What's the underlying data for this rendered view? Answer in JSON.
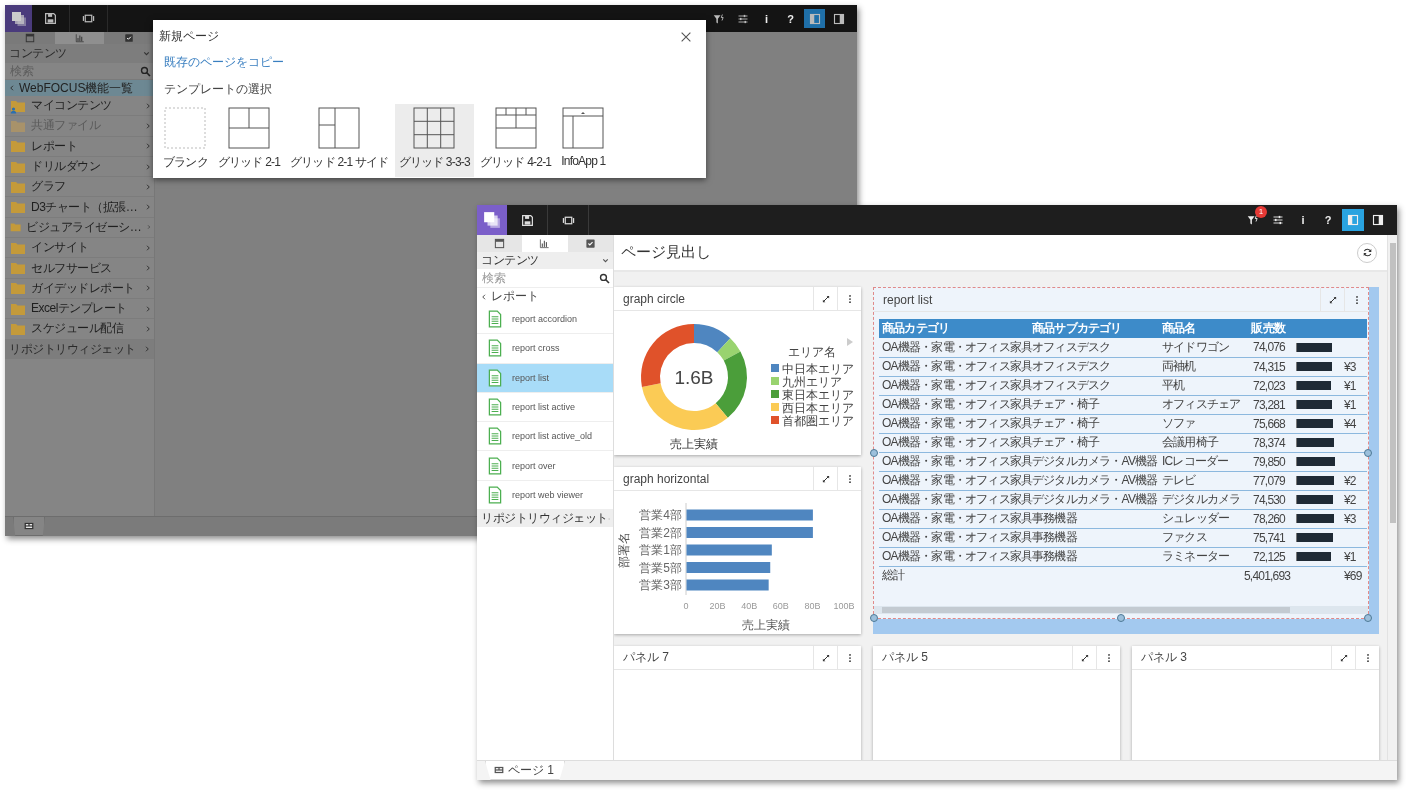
{
  "back_window": {
    "toolbar": {
      "left": [
        {
          "kind": "logo"
        },
        {
          "kind": "save"
        },
        {
          "kind": "slideshow"
        }
      ],
      "right": [
        {
          "kind": "filter",
          "selected": false
        },
        {
          "kind": "sliders",
          "selected": false
        },
        {
          "kind": "info",
          "label": "i",
          "selected": false
        },
        {
          "kind": "help",
          "label": "?",
          "selected": false
        },
        {
          "kind": "panel-left",
          "selected": true
        },
        {
          "kind": "panel-right",
          "selected": false
        }
      ]
    },
    "sidebar": {
      "tabs": [
        {
          "kind": "layout",
          "selected": false
        },
        {
          "kind": "chart",
          "selected": true
        },
        {
          "kind": "checkbox",
          "selected": false
        }
      ],
      "section": "コンテンツ",
      "search": {
        "placeholder": "検索"
      },
      "back": {
        "label": "WebFOCUS機能一覧",
        "highlighted": true
      },
      "items": [
        {
          "label": "マイコンテンツ",
          "kind": "user"
        },
        {
          "label": "共通ファイル",
          "kind": "shared"
        },
        {
          "label": "レポート",
          "kind": "folder"
        },
        {
          "label": "ドリルダウン",
          "kind": "folder"
        },
        {
          "label": "グラフ",
          "kind": "folder"
        },
        {
          "label": "D3チャート（拡張…",
          "kind": "folder"
        },
        {
          "label": "ビジュアライゼーシ…",
          "kind": "folder"
        },
        {
          "label": "インサイト",
          "kind": "folder"
        },
        {
          "label": "セルフサービス",
          "kind": "folder"
        },
        {
          "label": "ガイデッドレポート",
          "kind": "folder"
        },
        {
          "label": "Excelテンプレート",
          "kind": "folder"
        },
        {
          "label": "スケジュール配信",
          "kind": "folder"
        }
      ],
      "footer": "リポジトリウィジェット"
    }
  },
  "dialog": {
    "title": "新規ページ",
    "link": "既存のページをコピー",
    "heading": "テンプレートの選択",
    "templates": [
      {
        "label": "ブランク",
        "kind": "blank",
        "selected": false
      },
      {
        "label": "グリッド 2-1",
        "kind": "grid21",
        "selected": false
      },
      {
        "label": "グリッド 2-1 サイド",
        "kind": "grid21side",
        "selected": false
      },
      {
        "label": "グリッド 3-3-3",
        "kind": "grid333",
        "selected": true
      },
      {
        "label": "グリッド 4-2-1",
        "kind": "grid421",
        "selected": false
      },
      {
        "label": "InfoApp 1",
        "kind": "infoapp",
        "selected": false
      }
    ]
  },
  "front_window": {
    "toolbar": {
      "left": [
        {
          "kind": "logo"
        },
        {
          "kind": "save"
        },
        {
          "kind": "slideshow"
        }
      ],
      "right": [
        {
          "kind": "filter",
          "badge": "1",
          "selected": false
        },
        {
          "kind": "sliders",
          "selected": false
        },
        {
          "kind": "info",
          "label": "i",
          "selected": false
        },
        {
          "kind": "help",
          "label": "?",
          "selected": false
        },
        {
          "kind": "panel-left",
          "selected": true
        },
        {
          "kind": "panel-right",
          "selected": false
        }
      ]
    },
    "sidebar": {
      "tabs": [
        {
          "kind": "layout",
          "selected": false
        },
        {
          "kind": "chart",
          "selected": true
        },
        {
          "kind": "checkbox",
          "selected": false
        }
      ],
      "section": "コンテンツ",
      "search": {
        "placeholder": "検索"
      },
      "back": {
        "label": "レポート",
        "highlighted": false
      },
      "items": [
        {
          "label": "report accordion",
          "selected": false
        },
        {
          "label": "report cross",
          "selected": false
        },
        {
          "label": "report list",
          "selected": true
        },
        {
          "label": "report list active",
          "selected": false
        },
        {
          "label": "report list active_old",
          "selected": false
        },
        {
          "label": "report over",
          "selected": false
        },
        {
          "label": "report web viewer",
          "selected": false
        }
      ],
      "footer": "リポジトリウィジェット"
    },
    "page_title": "ページ見出し",
    "panels": [
      {
        "kind": "donut",
        "title": "graph circle",
        "selected": false,
        "center": "1.6B",
        "caption": "売上実績",
        "legend_title": "エリア名",
        "legend": [
          {
            "label": "中日本エリア",
            "color": "#4f86c0"
          },
          {
            "label": "九州エリア",
            "color": "#99d36f"
          },
          {
            "label": "東日本エリア",
            "color": "#4b9e3a"
          },
          {
            "label": "西日本エリア",
            "color": "#fbcb55"
          },
          {
            "label": "首都圏エリア",
            "color": "#e0522a"
          }
        ]
      },
      {
        "kind": "table",
        "title": "report list",
        "selected": true,
        "columns": [
          "商品カテゴリ",
          "商品サブカテゴリ",
          "商品名",
          "販売数"
        ],
        "rows": [
          {
            "category": "OA機器・家電・オフィス家具",
            "subcategory": "オフィスデスク",
            "product": "サイドワゴン",
            "sales": "74,076",
            "level": 0.86
          },
          {
            "category": "OA機器・家電・オフィス家具",
            "subcategory": "オフィスデスク",
            "product": "両袖机",
            "sales": "74,315",
            "level": 0.86,
            "column_6": "¥3"
          },
          {
            "category": "OA機器・家電・オフィス家具",
            "subcategory": "オフィスデスク",
            "product": "平机",
            "sales": "72,023",
            "level": 0.84,
            "column_6": "¥1"
          },
          {
            "category": "OA機器・家電・オフィス家具",
            "subcategory": "チェア・椅子",
            "product": "オフィスチェア",
            "sales": "73,281",
            "level": 0.85,
            "column_6": "¥1"
          },
          {
            "category": "OA機器・家電・オフィス家具",
            "subcategory": "チェア・椅子",
            "product": "ソファ",
            "sales": "75,668",
            "level": 0.88,
            "column_6": "¥4"
          },
          {
            "category": "OA機器・家電・オフィス家具",
            "subcategory": "チェア・椅子",
            "product": "会議用椅子",
            "sales": "78,374",
            "level": 0.91
          },
          {
            "category": "OA機器・家電・オフィス家具",
            "subcategory": "デジタルカメラ・AV機器",
            "product": "ICレコーダー",
            "sales": "79,850",
            "level": 0.93
          },
          {
            "category": "OA機器・家電・オフィス家具",
            "subcategory": "デジタルカメラ・AV機器",
            "product": "テレビ",
            "sales": "77,079",
            "level": 0.9,
            "column_6": "¥2"
          },
          {
            "category": "OA機器・家電・オフィス家具",
            "subcategory": "デジタルカメラ・AV機器",
            "product": "デジタルカメラ",
            "sales": "74,530",
            "level": 0.87,
            "column_6": "¥2"
          },
          {
            "category": "OA機器・家電・オフィス家具",
            "subcategory": "事務機器",
            "product": "シュレッダー",
            "sales": "78,260",
            "level": 0.91,
            "column_6": "¥3"
          },
          {
            "category": "OA機器・家電・オフィス家具",
            "subcategory": "事務機器",
            "product": "ファクス",
            "sales": "75,741",
            "level": 0.88
          },
          {
            "category": "OA機器・家電・オフィス家具",
            "subcategory": "事務機器",
            "product": "ラミネーター",
            "sales": "72,125",
            "level": 0.84,
            "column_6": "¥1"
          }
        ],
        "total": {
          "label": "総計",
          "sales": "5,401,693",
          "column_6": "¥69"
        }
      },
      {
        "kind": "bar",
        "title": "graph horizontal",
        "selected": false,
        "chart_data": {
          "type": "bar",
          "orientation": "horizontal",
          "categories": [
            "営業4部",
            "営業2部",
            "営業1部",
            "営業5部",
            "営業3部"
          ],
          "series": [
            {
              "color": "#4f86c0",
              "values": [
                80,
                80,
                54,
                53,
                52
              ]
            }
          ],
          "xlabel": "売上実績",
          "ylabel": "部署名",
          "xlim": [
            0,
            100
          ],
          "xticks": [
            {
              "value": 0,
              "label": "0"
            },
            {
              "value": 20,
              "label": "20B"
            },
            {
              "value": 40,
              "label": "40B"
            },
            {
              "value": 60,
              "label": "60B"
            },
            {
              "value": 80,
              "label": "80B"
            },
            {
              "value": 100,
              "label": "100B"
            }
          ]
        }
      },
      {
        "kind": "empty",
        "title": "パネル 7",
        "selected": false
      },
      {
        "kind": "empty",
        "title": "パネル 5",
        "selected": false
      },
      {
        "kind": "empty",
        "title": "パネル 3",
        "selected": false
      }
    ],
    "page_tab": "ページ 1"
  }
}
